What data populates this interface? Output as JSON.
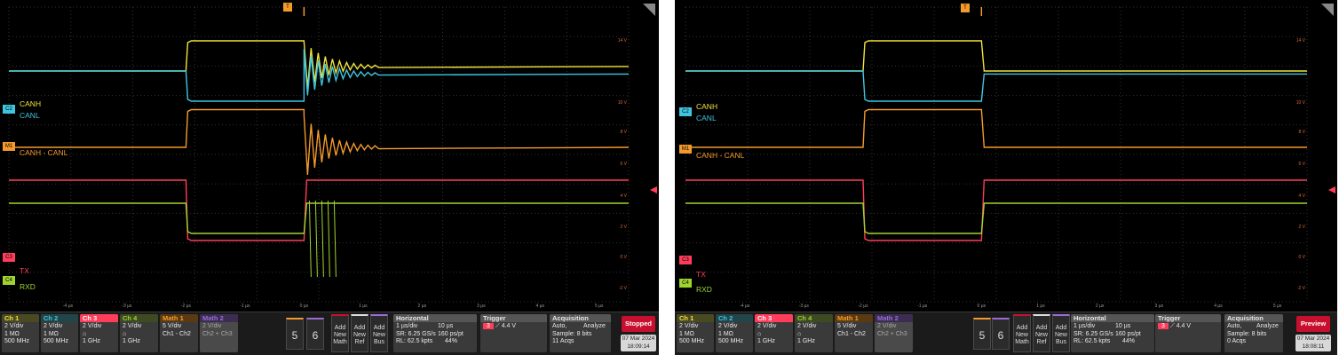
{
  "colors": {
    "ch1": "#f2e23a",
    "ch2": "#3ec6e0",
    "ch3": "#ff3d5a",
    "ch4": "#9fd42f",
    "math1": "#f39a2b",
    "math2": "#9b6bd6",
    "stopped": "#c8102e"
  },
  "screens": [
    {
      "trace_labels": {
        "canh": "CANH",
        "canl": "CANL",
        "diff": "CANH - CANL",
        "tx": "TX",
        "rxd": "RXD"
      },
      "tags": {
        "c2": "C2",
        "m1": "M1",
        "c3": "C3",
        "c4": "C4",
        "trig": "T"
      },
      "y_ticks": [
        "14 V",
        "10 V",
        "8 V",
        "6 V",
        "4 V",
        "2 V",
        "0 V",
        "-2 V"
      ],
      "x_ticks": [
        "-4 µs",
        "-3 µs",
        "-2 µs",
        "-1 µs",
        "0 µs",
        "1 µs",
        "2 µs",
        "3 µs",
        "4 µs",
        "5 µs"
      ],
      "channels": [
        {
          "name": "Ch 1",
          "l1": "2 V/div",
          "l2": "1 MΩ",
          "l3": "500 MHz"
        },
        {
          "name": "Ch 2",
          "l1": "2 V/div",
          "l2": "1 MΩ",
          "l3": "500 MHz"
        },
        {
          "name": "Ch 3",
          "l1": "2 V/div",
          "l2": "",
          "l3": "1 GHz"
        },
        {
          "name": "Ch 4",
          "l1": "2 V/div",
          "l2": "",
          "l3": "1 GHz"
        },
        {
          "name": "Math 1",
          "l1": "5 V/div",
          "l2": "Ch1 - Ch2",
          "l3": ""
        },
        {
          "name": "Math 2",
          "l1": "2 V/div",
          "l2": "Ch2 + Ch3",
          "l3": ""
        }
      ],
      "buttons": {
        "b5": "5",
        "b6": "6",
        "math": "Add New Math",
        "ref": "Add New Ref",
        "bus": "Add New Bus"
      },
      "horizontal": {
        "title": "Horizontal",
        "a1": "1 µs/div",
        "a2": "10 µs",
        "b1": "SR: 6.25 GS/s",
        "b2": "160 ps/pt",
        "c1": "RL: 62.5 kpts",
        "c2": "44%"
      },
      "trigger": {
        "title": "Trigger",
        "src": "3",
        "level": "4.4 V"
      },
      "acquisition": {
        "title": "Acquisition",
        "a1": "Auto,",
        "a2": "Analyze",
        "b": "Sample: 8 bits",
        "c": "11 Acqs"
      },
      "state": "Stopped",
      "date": "07 Mar 2024",
      "time": "18:09:14"
    },
    {
      "trace_labels": {
        "canh": "CANH",
        "canl": "CANL",
        "diff": "CANH - CANL",
        "tx": "TX",
        "rxd": "RXD"
      },
      "tags": {
        "c2": "C2",
        "m1": "M1",
        "c3": "C3",
        "c4": "C4",
        "trig": "T"
      },
      "y_ticks": [
        "14 V",
        "10 V",
        "8 V",
        "6 V",
        "4 V",
        "2 V",
        "0 V",
        "-2 V"
      ],
      "x_ticks": [
        "-4 µs",
        "-3 µs",
        "-2 µs",
        "-1 µs",
        "0 µs",
        "1 µs",
        "2 µs",
        "3 µs",
        "4 µs",
        "5 µs"
      ],
      "channels": [
        {
          "name": "Ch 1",
          "l1": "2 V/div",
          "l2": "1 MΩ",
          "l3": "500 MHz"
        },
        {
          "name": "Ch 2",
          "l1": "2 V/div",
          "l2": "1 MΩ",
          "l3": "500 MHz"
        },
        {
          "name": "Ch 3",
          "l1": "2 V/div",
          "l2": "",
          "l3": "1 GHz"
        },
        {
          "name": "Ch 4",
          "l1": "2 V/div",
          "l2": "",
          "l3": "1 GHz"
        },
        {
          "name": "Math 1",
          "l1": "5 V/div",
          "l2": "Ch1 - Ch2",
          "l3": ""
        },
        {
          "name": "Math 2",
          "l1": "2 V/div",
          "l2": "Ch2 + Ch3",
          "l3": ""
        }
      ],
      "buttons": {
        "b5": "5",
        "b6": "6",
        "math": "Add New Math",
        "ref": "Add New Ref",
        "bus": "Add New Bus"
      },
      "horizontal": {
        "title": "Horizontal",
        "a1": "1 µs/div",
        "a2": "10 µs",
        "b1": "SR: 6.25 GS/s",
        "b2": "160 ps/pt",
        "c1": "RL: 62.5 kpts",
        "c2": "44%"
      },
      "trigger": {
        "title": "Trigger",
        "src": "3",
        "level": "4.4 V"
      },
      "acquisition": {
        "title": "Acquisition",
        "a1": "Auto,",
        "a2": "Analyze",
        "b": "Sample: 8 bits",
        "c": "0 Acqs"
      },
      "state": "Preview",
      "date": "07 Mar 2024",
      "time": "18:08:11"
    }
  ],
  "chart_data": [
    {
      "type": "line",
      "title": "",
      "xlabel": "",
      "ylabel": "",
      "x_unit": "µs",
      "xlim": [
        -5,
        5.5
      ],
      "ylim": [
        -2,
        15
      ],
      "grid": true,
      "x": [
        -5,
        -2,
        0,
        5.5
      ],
      "series": [
        {
          "name": "CANH",
          "values": [
            12.5,
            14.5,
            12.8,
            12.3
          ]
        },
        {
          "name": "CANL",
          "values": [
            12.5,
            10.5,
            12.3,
            12.3
          ]
        },
        {
          "name": "CANH - CANL",
          "values": [
            5.5,
            8.0,
            5.5,
            5.5
          ]
        },
        {
          "name": "TX",
          "values": [
            3.5,
            -0.5,
            3.5,
            3.5
          ]
        },
        {
          "name": "RXD",
          "values": [
            -0.5,
            -2.5,
            -0.5,
            -0.5
          ]
        }
      ],
      "ringing_after_dominant": true
    },
    {
      "type": "line",
      "title": "",
      "xlabel": "",
      "ylabel": "",
      "x_unit": "µs",
      "xlim": [
        -5,
        5.5
      ],
      "ylim": [
        -2,
        15
      ],
      "grid": true,
      "x": [
        -5,
        -2,
        0,
        5.5
      ],
      "series": [
        {
          "name": "CANH",
          "values": [
            12.5,
            14.5,
            12.5,
            12.3
          ]
        },
        {
          "name": "CANL",
          "values": [
            12.5,
            10.5,
            12.3,
            12.3
          ]
        },
        {
          "name": "CANH - CANL",
          "values": [
            5.5,
            8.0,
            5.5,
            5.5
          ]
        },
        {
          "name": "TX",
          "values": [
            3.5,
            -0.5,
            3.5,
            3.5
          ]
        },
        {
          "name": "RXD",
          "values": [
            -0.5,
            -2.5,
            -0.5,
            -0.5
          ]
        }
      ],
      "ringing_after_dominant": false
    }
  ]
}
